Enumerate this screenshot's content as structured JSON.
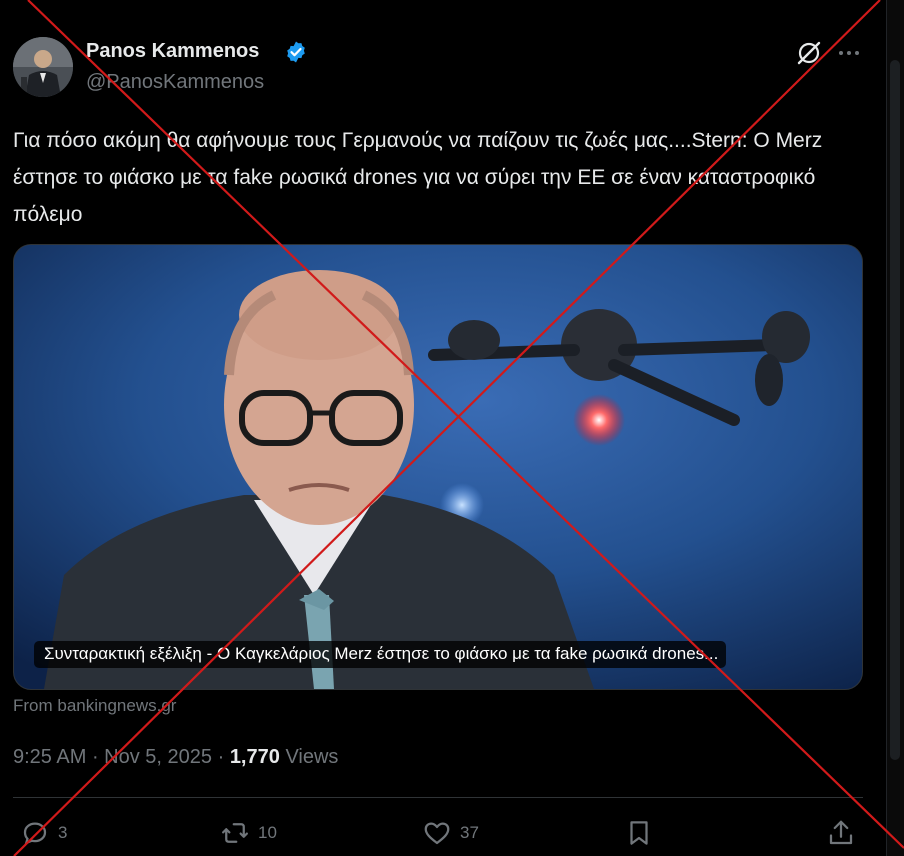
{
  "author": {
    "display_name": "Panos Kammenos",
    "handle": "@PanosKammenos",
    "verified": true,
    "verified_color": "#1d9bf0"
  },
  "tweet": {
    "text": "Για πόσο ακόμη θα αφήνουμε τους Γερμανούς να παίζουν τις ζωές μας....Stern: Ο Merz έστησε το φιάσκο με τα fake ρωσικά drones για να σύρει την ΕΕ σε έναν καταστροφικό πόλεμο"
  },
  "link_card": {
    "caption": "Συνταρακτική εξέλιξη - Ο Καγκελάριος Merz έστησε το φιάσκο με τα fake ρωσικά drones...",
    "source": "From bankingnews.gr"
  },
  "meta": {
    "time": "9:25 AM",
    "date": "Nov 5, 2025",
    "views_count": "1,770",
    "views_label": "Views"
  },
  "actions": {
    "replies": "3",
    "reposts": "10",
    "likes": "37"
  },
  "icons": [
    "grok-icon",
    "more-icon",
    "reply-icon",
    "repost-icon",
    "like-icon",
    "bookmark-icon",
    "share-icon",
    "verified-badge-icon"
  ],
  "overlay": {
    "cross_color": "#d11a1a"
  }
}
